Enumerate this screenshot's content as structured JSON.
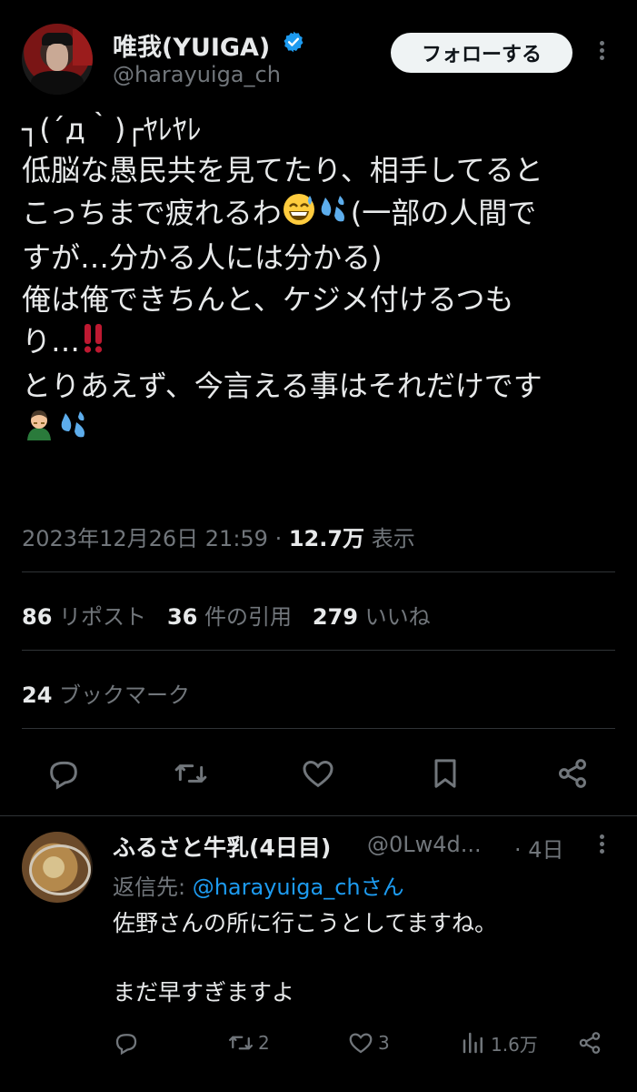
{
  "tweet": {
    "author_name": "唯我(YUIGA)",
    "author_handle": "@harayuiga_ch",
    "follow_label": "フォローする",
    "text_line1": "┐(´д｀)┌ﾔﾚﾔﾚ",
    "text_line2": "低脳な愚民共を見てたり、相手してると",
    "text_line3a": "こっちまで疲れるわ",
    "text_line3b": "(一部の人間で",
    "text_line4": "すが…分かる人には分かる)",
    "text_line5": "俺は俺できちんと、ケジメ付けるつも",
    "text_line6": "り…",
    "text_line7": "とりあえず、今言える事はそれだけです",
    "timestamp": "2023年12月26日 21:59 · ",
    "views_count": "12.7万",
    "views_label": " 表示",
    "reposts_count": "86",
    "reposts_label": " リポスト",
    "quotes_count": "36",
    "quotes_label": " 件の引用",
    "likes_count": "279",
    "likes_label": " いいね",
    "bookmarks_count": "24",
    "bookmarks_label": " ブックマーク"
  },
  "reply": {
    "author_name": "ふるさと牛乳(4日目)",
    "author_handle": "@0Lw4d...",
    "time": "· 4日",
    "reply_to_prefix": "返信先: ",
    "reply_to_handle": "@harayuiga_chさん",
    "text": "佐野さんの所に行こうとしてますね。\n\nまだ早すぎますよ",
    "retweets": "2",
    "likes": "3",
    "views": "1.6万"
  },
  "colors": {
    "background": "#000000",
    "primary_text": "#e7e9ea",
    "secondary_text": "#71767b",
    "link": "#1d9bf0",
    "verified": "#1d9bf0",
    "divider": "#2f3336"
  },
  "icons": [
    "verified-badge-icon",
    "more-icon",
    "reply-icon",
    "retweet-icon",
    "like-icon",
    "bookmark-icon",
    "share-icon",
    "views-icon"
  ]
}
